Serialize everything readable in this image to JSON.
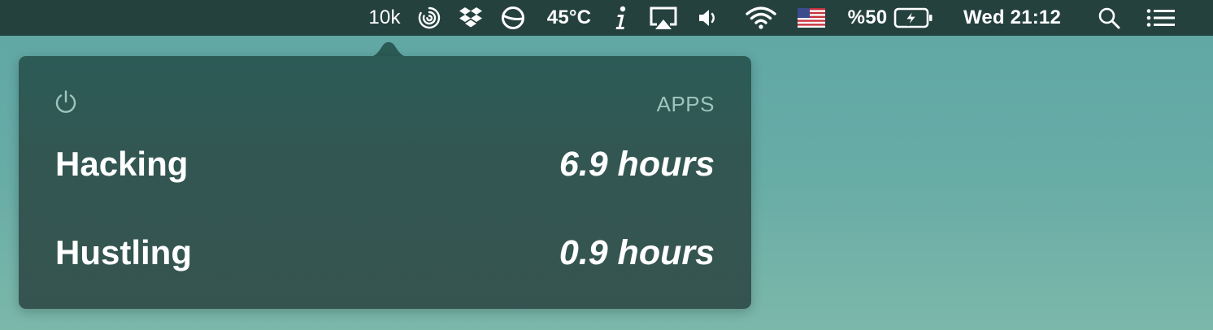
{
  "menubar": {
    "steps": "10k",
    "temperature": "45°C",
    "battery_percent": "%50",
    "clock": "Wed 21:12",
    "icons": [
      "swirl-icon",
      "dropbox-icon",
      "half-circle-icon",
      "info-icon",
      "airplay-icon",
      "volume-icon",
      "wifi-icon",
      "us-flag-icon",
      "battery-charging-icon",
      "search-icon",
      "list-menu-icon"
    ]
  },
  "popover": {
    "power_icon": "power-icon",
    "apps_label": "APPS",
    "rows": [
      {
        "label": "Hacking",
        "value": "6.9 hours"
      },
      {
        "label": "Hustling",
        "value": "0.9 hours"
      }
    ]
  },
  "colors": {
    "menubar_bg": "#24413e",
    "popover_bg": "#315853",
    "apps_label": "#9ec4bf",
    "desktop": "#64a9a5"
  }
}
